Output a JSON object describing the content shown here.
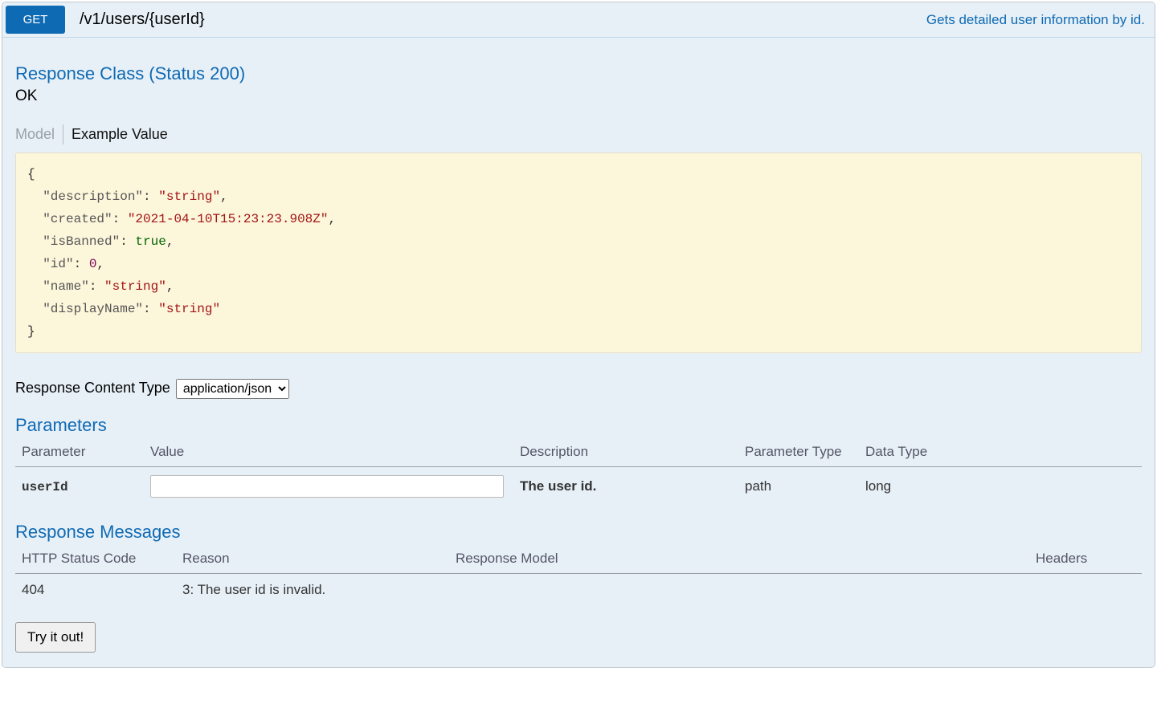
{
  "operation": {
    "method": "GET",
    "path": "/v1/users/{userId}",
    "summary": "Gets detailed user information by id."
  },
  "response_class": {
    "title": "Response Class (Status 200)",
    "status_text": "OK",
    "tabs": {
      "model": "Model",
      "example": "Example Value"
    },
    "example_tokens": [
      {
        "t": "{",
        "c": "p"
      },
      {
        "t": "\n  ",
        "c": "p"
      },
      {
        "t": "\"description\"",
        "c": "k"
      },
      {
        "t": ": ",
        "c": "p"
      },
      {
        "t": "\"string\"",
        "c": "s"
      },
      {
        "t": ",",
        "c": "p"
      },
      {
        "t": "\n  ",
        "c": "p"
      },
      {
        "t": "\"created\"",
        "c": "k"
      },
      {
        "t": ": ",
        "c": "p"
      },
      {
        "t": "\"2021-04-10T15:23:23.908Z\"",
        "c": "s"
      },
      {
        "t": ",",
        "c": "p"
      },
      {
        "t": "\n  ",
        "c": "p"
      },
      {
        "t": "\"isBanned\"",
        "c": "k"
      },
      {
        "t": ": ",
        "c": "p"
      },
      {
        "t": "true",
        "c": "b"
      },
      {
        "t": ",",
        "c": "p"
      },
      {
        "t": "\n  ",
        "c": "p"
      },
      {
        "t": "\"id\"",
        "c": "k"
      },
      {
        "t": ": ",
        "c": "p"
      },
      {
        "t": "0",
        "c": "n"
      },
      {
        "t": ",",
        "c": "p"
      },
      {
        "t": "\n  ",
        "c": "p"
      },
      {
        "t": "\"name\"",
        "c": "k"
      },
      {
        "t": ": ",
        "c": "p"
      },
      {
        "t": "\"string\"",
        "c": "s"
      },
      {
        "t": ",",
        "c": "p"
      },
      {
        "t": "\n  ",
        "c": "p"
      },
      {
        "t": "\"displayName\"",
        "c": "k"
      },
      {
        "t": ": ",
        "c": "p"
      },
      {
        "t": "\"string\"",
        "c": "s"
      },
      {
        "t": "\n",
        "c": "p"
      },
      {
        "t": "}",
        "c": "p"
      }
    ]
  },
  "content_type": {
    "label": "Response Content Type",
    "selected": "application/json"
  },
  "parameters": {
    "title": "Parameters",
    "headers": {
      "param": "Parameter",
      "value": "Value",
      "desc": "Description",
      "ptype": "Parameter Type",
      "dtype": "Data Type"
    },
    "rows": [
      {
        "name": "userId",
        "value": "",
        "desc": "The user id.",
        "ptype": "path",
        "dtype": "long"
      }
    ]
  },
  "responses": {
    "title": "Response Messages",
    "headers": {
      "code": "HTTP Status Code",
      "reason": "Reason",
      "model": "Response Model",
      "headers": "Headers"
    },
    "rows": [
      {
        "code": "404",
        "reason": "3: The user id is invalid.",
        "model": "",
        "headers": ""
      }
    ]
  },
  "try_label": "Try it out!"
}
